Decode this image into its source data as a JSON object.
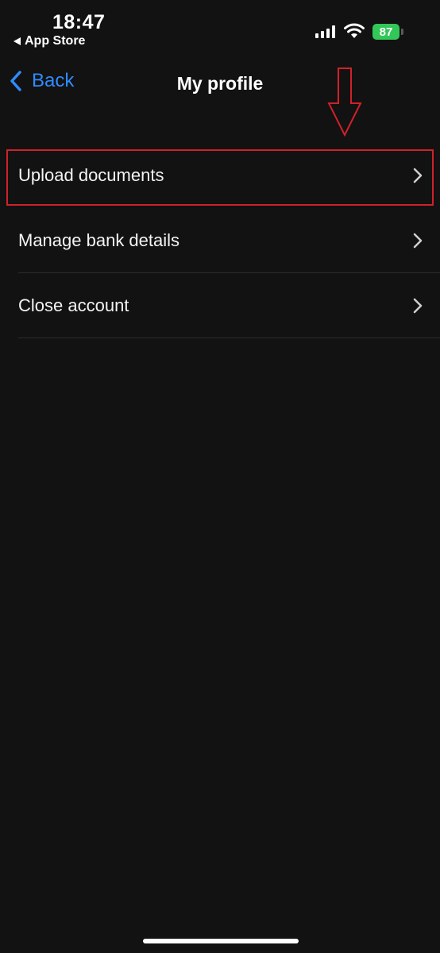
{
  "status_bar": {
    "time": "18:47",
    "back_app_label": "App Store",
    "battery_level": "87",
    "battery_color": "#33c759",
    "icons": [
      "signal-icon",
      "wifi-icon",
      "battery-icon"
    ]
  },
  "nav": {
    "back_label": "Back",
    "title": "My profile",
    "accent_color": "#2f8cff"
  },
  "list": {
    "items": [
      {
        "label": "Upload documents",
        "highlighted": true
      },
      {
        "label": "Manage bank details"
      },
      {
        "label": "Close account"
      }
    ]
  },
  "annotation": {
    "color": "#d0212a",
    "arrow_icon": "down-arrow-icon"
  }
}
